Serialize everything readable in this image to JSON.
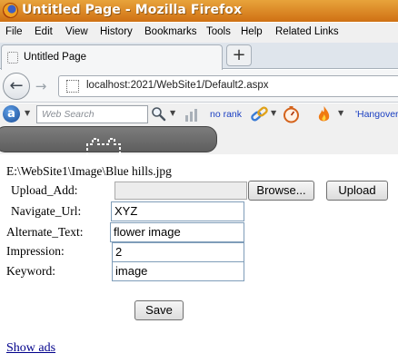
{
  "window": {
    "title": "Untitled Page - Mozilla Firefox"
  },
  "menu": [
    "File",
    "Edit",
    "View",
    "History",
    "Bookmarks",
    "Tools",
    "Help",
    "Related Links"
  ],
  "tab": {
    "label": "Untitled Page",
    "new_tab_symbol": "+"
  },
  "nav": {
    "url": "localhost:2021/WebSite1/Default2.aspx",
    "back_symbol": "←",
    "forward_symbol": "→"
  },
  "toolbar": {
    "logo_letter": "a",
    "search_placeholder": "Web Search",
    "rank_text": "no rank",
    "hangover_text": "'Hangover"
  },
  "form": {
    "image_path": "E:\\WebSite1\\Image\\Blue hills.jpg",
    "upload_label": "Upload_Add:",
    "browse_button": "Browse...",
    "upload_button": "Upload",
    "navigate_label": "Navigate_Url:",
    "navigate_value": "XYZ",
    "alternate_label": "Alternate_Text:",
    "alternate_value": "flower image",
    "impression_label": "Impression:",
    "impression_value": "2",
    "keyword_label": "Keyword:",
    "keyword_value": "image",
    "save_button": "Save",
    "show_ads_link": "Show ads"
  },
  "icons": {
    "firefox_logo": "firefox-logo-icon",
    "search": "magnifier-icon",
    "stats": "bar-chart-icon",
    "links": "chain-link-icon",
    "speed": "dial-icon",
    "hot": "flame-icon"
  },
  "colors": {
    "titlebar": "#cf7114",
    "link": "#00008b",
    "toolbar_link": "#1a3fc2"
  }
}
